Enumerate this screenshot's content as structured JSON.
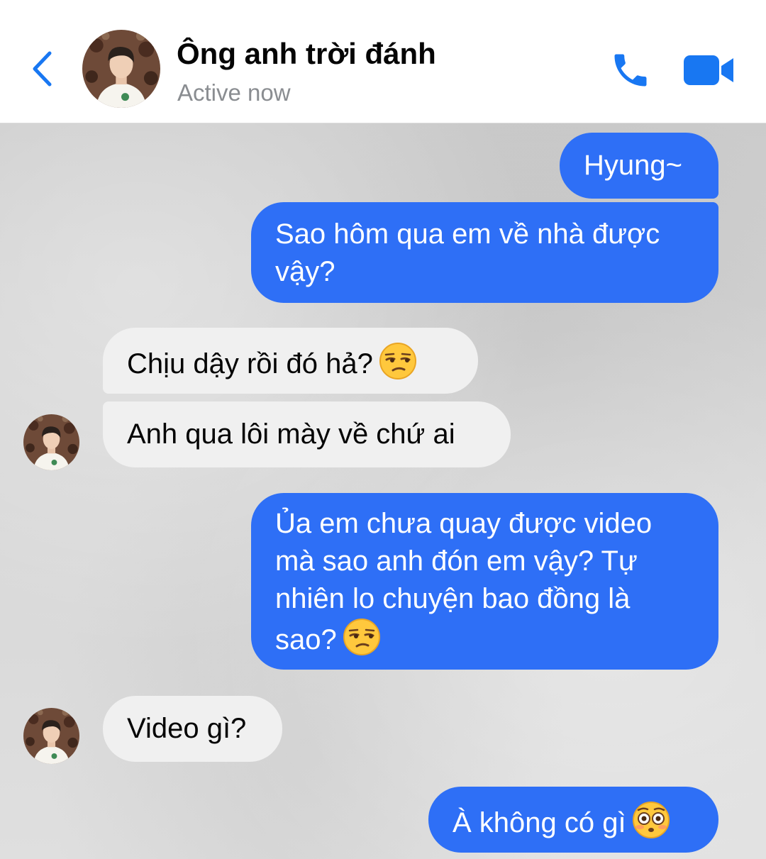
{
  "header": {
    "contact_name": "Ông anh trời đánh",
    "status": "Active now",
    "icons": {
      "back": "chevron-left-icon",
      "call": "phone-icon",
      "video": "video-camera-icon"
    },
    "accent_color": "#1877f2"
  },
  "messages": [
    {
      "sender": "me",
      "lines": [
        "Hyung~"
      ]
    },
    {
      "sender": "me",
      "lines": [
        "Sao hôm qua em về nhà được",
        "vậy?"
      ]
    },
    {
      "sender": "contact",
      "lines": [
        "Chịu dậy rồi đó hả?"
      ],
      "emoji": "unamused-face"
    },
    {
      "sender": "contact",
      "lines": [
        "Anh qua lôi mày về chứ ai"
      ]
    },
    {
      "sender": "me",
      "lines": [
        "Ủa em chưa quay được video",
        "mà sao anh đón em vậy? Tự",
        "nhiên lo chuyện bao đồng là",
        "sao?"
      ],
      "emoji": "unamused-face"
    },
    {
      "sender": "contact",
      "lines": [
        "Video gì?"
      ]
    },
    {
      "sender": "me",
      "lines": [
        "À không có gì"
      ],
      "emoji": "flushed-face"
    }
  ],
  "colors": {
    "outgoing_bubble": "#2e6ff6",
    "incoming_bubble": "#f0f0f0"
  }
}
